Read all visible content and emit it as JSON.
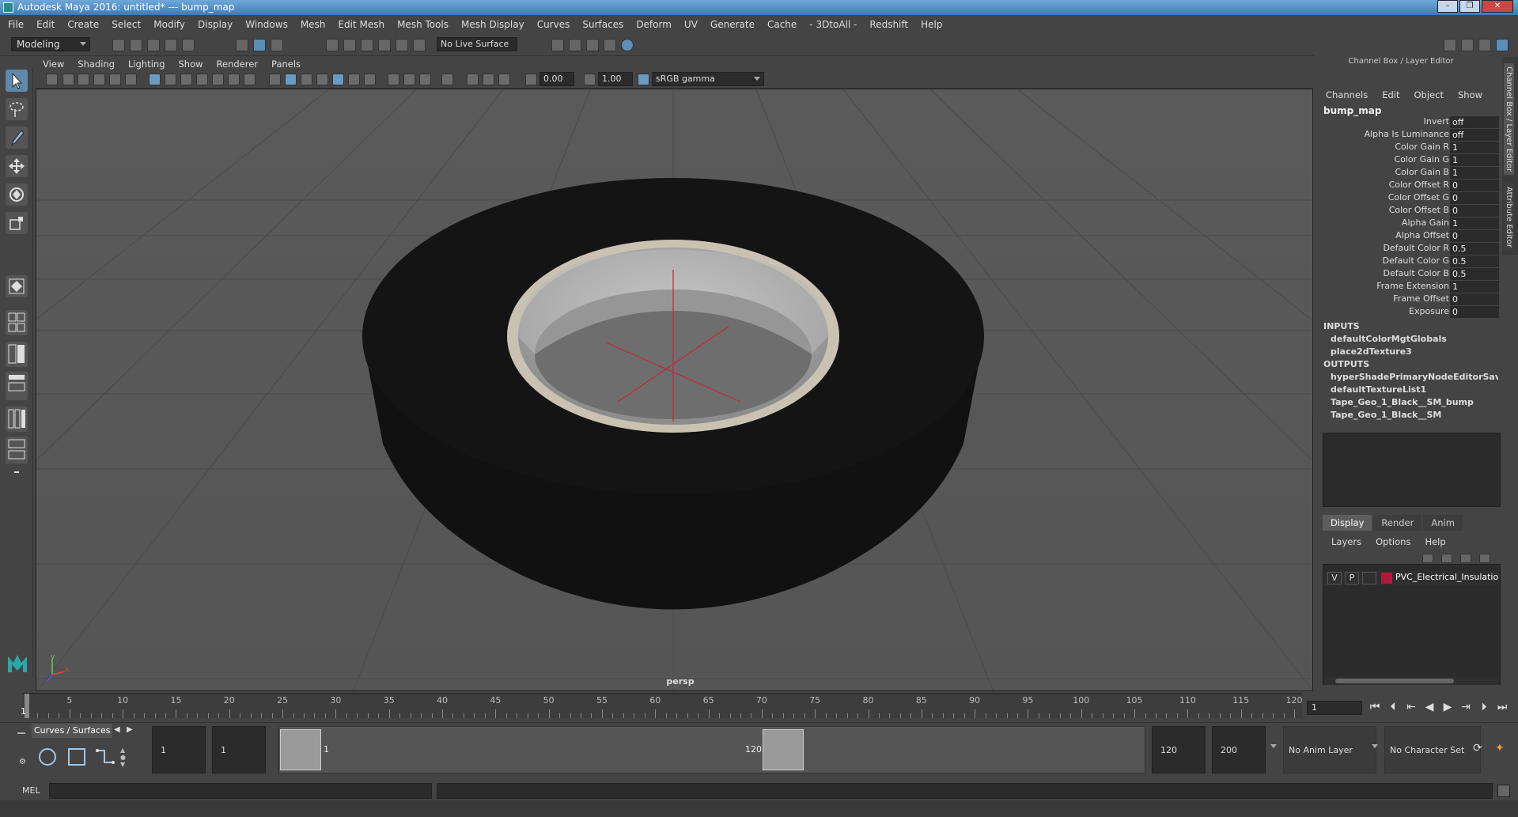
{
  "window": {
    "title": "Autodesk Maya 2016: untitled*    ---    bump_map",
    "buttons": [
      "–",
      "❐",
      "✕"
    ]
  },
  "menubar": [
    "File",
    "Edit",
    "Create",
    "Select",
    "Modify",
    "Display",
    "Windows",
    "Mesh",
    "Edit Mesh",
    "Mesh Tools",
    "Mesh Display",
    "Curves",
    "Surfaces",
    "Deform",
    "UV",
    "Generate",
    "Cache",
    "- 3DtoAll -",
    "Redshift",
    "Help"
  ],
  "status_line": {
    "mode": "Modeling",
    "live_surface": "No Live Surface"
  },
  "panel_menu": [
    "View",
    "Shading",
    "Lighting",
    "Show",
    "Renderer",
    "Panels"
  ],
  "panel_toolbar": {
    "exposure": "0.00",
    "gamma": "1.00",
    "color_space": "sRGB gamma"
  },
  "viewport": {
    "camera_label": "persp",
    "axis_labels": {
      "y": "y",
      "x": "x"
    }
  },
  "channel_box": {
    "title": "Channel Box / Layer Editor",
    "menus": [
      "Channels",
      "Edit",
      "Object",
      "Show"
    ],
    "node": "bump_map",
    "attributes": [
      {
        "label": "Invert",
        "value": "off"
      },
      {
        "label": "Alpha Is Luminance",
        "value": "off"
      },
      {
        "label": "Color Gain R",
        "value": "1"
      },
      {
        "label": "Color Gain G",
        "value": "1"
      },
      {
        "label": "Color Gain B",
        "value": "1"
      },
      {
        "label": "Color Offset R",
        "value": "0"
      },
      {
        "label": "Color Offset G",
        "value": "0"
      },
      {
        "label": "Color Offset B",
        "value": "0"
      },
      {
        "label": "Alpha Gain",
        "value": "1"
      },
      {
        "label": "Alpha Offset",
        "value": "0"
      },
      {
        "label": "Default Color R",
        "value": "0.5"
      },
      {
        "label": "Default Color G",
        "value": "0.5"
      },
      {
        "label": "Default Color B",
        "value": "0.5"
      },
      {
        "label": "Frame Extension",
        "value": "1"
      },
      {
        "label": "Frame Offset",
        "value": "0"
      },
      {
        "label": "Exposure",
        "value": "0"
      }
    ],
    "inputs_label": "INPUTS",
    "inputs": [
      "defaultColorMgtGlobals",
      "place2dTexture3"
    ],
    "outputs_label": "OUTPUTS",
    "outputs": [
      "hyperShadePrimaryNodeEditorSavedT...",
      "defaultTextureList1",
      "Tape_Geo_1_Black__SM_bump",
      "Tape_Geo_1_Black__SM"
    ]
  },
  "side_tabs": [
    "Channel Box / Layer Editor",
    "Attribute Editor"
  ],
  "layer_editor": {
    "tabs": [
      "Display",
      "Render",
      "Anim"
    ],
    "menus": [
      "Layers",
      "Options",
      "Help"
    ],
    "layer": {
      "v": "V",
      "p": "P",
      "name": "PVC_Electrical_Insulation",
      "color": "#b01a3a"
    }
  },
  "time_slider": {
    "ticks": [
      "5",
      "10",
      "15",
      "20",
      "25",
      "30",
      "35",
      "40",
      "45",
      "50",
      "55",
      "60",
      "65",
      "70",
      "75",
      "80",
      "85",
      "90",
      "95",
      "100",
      "105",
      "110",
      "115",
      "120"
    ],
    "start_label": "1",
    "current_frame": "1"
  },
  "shelf": {
    "tab": "Curves / Surfaces"
  },
  "range_slider": {
    "start_time": "1",
    "playback_start": "1",
    "range_start_label": "1",
    "range_end_label": "120",
    "playback_end": "120",
    "end_time": "200",
    "anim_layer": "No Anim Layer",
    "character_set": "No Character Set"
  },
  "command_line": {
    "label": "MEL"
  },
  "colors": {
    "ui_bg": "#444444",
    "field_bg": "#2b2b2b",
    "highlight": "#5f89aa",
    "layer_color": "#b01a3a"
  }
}
